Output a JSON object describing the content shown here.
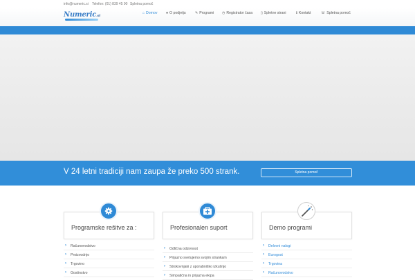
{
  "topbar": {
    "email": "info@numeric.si",
    "phone": "Telefon: (01) 839 45 90",
    "help": "Spletna pomoč"
  },
  "logo": {
    "text": "Numeric",
    "tld": ".si"
  },
  "nav": [
    {
      "label": "Domov",
      "icon": "home-icon",
      "active": true
    },
    {
      "label": "O podjetju",
      "icon": "user-icon"
    },
    {
      "label": "Programi",
      "icon": "edit-icon"
    },
    {
      "label": "Registrator časa",
      "icon": "clock-icon"
    },
    {
      "label": "Spletne strani",
      "icon": "tablet-icon"
    },
    {
      "label": "Kontakt",
      "icon": "info-icon"
    },
    {
      "label": "Spletna pomoč",
      "icon": "help-icon"
    }
  ],
  "banner": {
    "text": "V 24 letni tradiciji nam zaupa že preko 500 strank.",
    "button": "Spletna pomoč"
  },
  "cards": [
    {
      "title": "Programske rešitve za :",
      "icon": "gear-icon",
      "items": [
        "Računovodstvo",
        "Proizvodnjo",
        "Trgovino",
        "Gostinstvo"
      ],
      "links": false
    },
    {
      "title": "Profesionalen suport",
      "icon": "medkit-icon",
      "items": [
        "Odlična odzivnost",
        "Prijazno svetujemo svojim strankam",
        "Strokovnjaki z uporabniško izkušnjo",
        "Simpatična in prijazna ekipa"
      ],
      "links": false
    },
    {
      "title": "Demo programi",
      "icon": "magic-wand-icon",
      "items": [
        "Delovni nalogi",
        "Eurogost",
        "Trgovina",
        "Računovodstvo"
      ],
      "links": true
    }
  ],
  "colors": {
    "accent": "#2f8ad6",
    "banner": "#318ed9",
    "link": "#2e8ad8"
  }
}
